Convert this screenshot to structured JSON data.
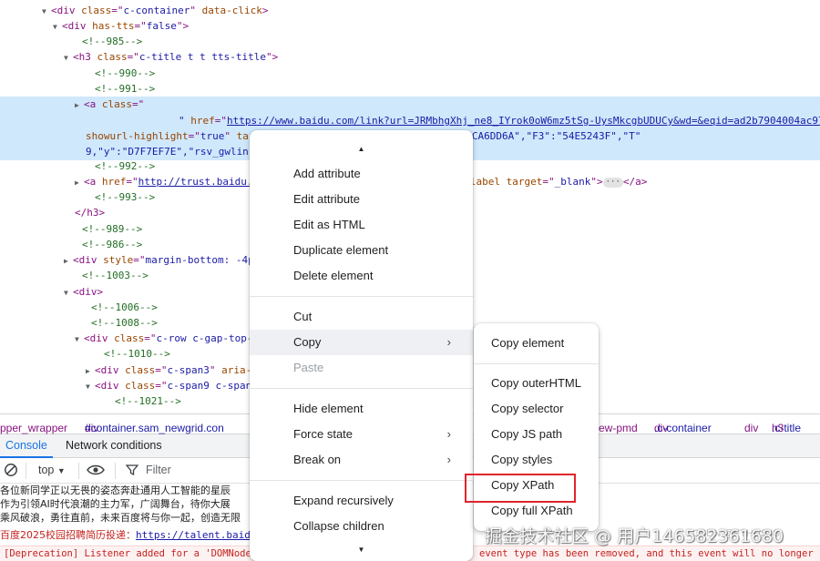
{
  "elements": {
    "lines": [
      {
        "tokens": [
          [
            "tri",
            "▼"
          ],
          [
            "tag",
            "<div "
          ],
          [
            "attr",
            "class"
          ],
          [
            "tag",
            "=\""
          ],
          [
            "val",
            "c-container"
          ],
          [
            "tag",
            "\" "
          ],
          [
            "attr",
            "data-click"
          ],
          [
            "tag",
            ">"
          ]
        ]
      },
      {
        "tokens": [
          [
            "tri",
            "▼"
          ],
          [
            "tag",
            "<div "
          ],
          [
            "attr",
            "has-tts"
          ],
          [
            "tag",
            "=\""
          ],
          [
            "val",
            "false"
          ],
          [
            "tag",
            "\">"
          ]
        ]
      },
      {
        "tokens": [
          [
            "cmt",
            "<!--985-->"
          ]
        ]
      },
      {
        "tokens": [
          [
            "tri",
            "▼"
          ],
          [
            "tag",
            "<h3 "
          ],
          [
            "attr",
            "class"
          ],
          [
            "tag",
            "=\""
          ],
          [
            "val",
            "c-title t t tts-title"
          ],
          [
            "tag",
            "\">"
          ]
        ]
      },
      {
        "tokens": [
          [
            "cmt",
            "<!--990-->"
          ]
        ]
      },
      {
        "tokens": [
          [
            "cmt",
            "<!--991-->"
          ]
        ]
      },
      {
        "tokens": [
          [
            "tri",
            "▶"
          ],
          [
            "tag",
            "<a "
          ],
          [
            "attr",
            "class"
          ],
          [
            "tag",
            "=\""
          ]
        ]
      },
      {
        "tokens": [
          [
            "val",
            "\" "
          ],
          [
            "attr",
            "href"
          ],
          [
            "tag",
            "=\""
          ],
          [
            "link",
            "https://www.baidu.com/link?url=JRMbhgXhj_ne8_IYrok0oW6mz5tSg-UysMkcgbUDUCy&wd=&eqid=ad2b7904004ac97b000000066"
          ]
        ]
      },
      {
        "tokens": [
          [
            "attr",
            "showurl-highlight"
          ],
          [
            "tag",
            "=\""
          ],
          [
            "val",
            "true"
          ],
          [
            "tag",
            "\" "
          ],
          [
            "attr",
            "targ"
          ],
          [
            "val",
            "                                                  \"778317EA\",\"F1\":\"9D73F1E4\",\"F2\":\"4CA6DD6A\",\"F3\":\"54E5243F\",\"T\""
          ]
        ]
      },
      {
        "tokens": [
          [
            "val",
            "9,\"y\":\"D7F7EF7E\",\"rsv_gwlink\""
          ]
        ]
      },
      {
        "tokens": [
          [
            "cmt",
            "<!--992-->"
          ]
        ]
      },
      {
        "tokens": [
          [
            "tri",
            "▶"
          ],
          [
            "tag",
            "<a "
          ],
          [
            "attr",
            "href"
          ],
          [
            "tag",
            "=\""
          ],
          [
            "link",
            "http://trust.baidu."
          ],
          [
            "val",
            "                                                        label_2A093 c-gap-left-small\" "
          ],
          [
            "attr",
            "aria-label target"
          ],
          [
            "tag",
            "=\""
          ],
          [
            "val",
            "_blank"
          ],
          [
            "tag",
            "\">"
          ],
          [
            "ell",
            "···"
          ],
          [
            "tag",
            "</a>"
          ]
        ]
      },
      {
        "tokens": [
          [
            "cmt",
            "<!--993-->"
          ]
        ]
      },
      {
        "tokens": [
          [
            "tag",
            "</h3>"
          ]
        ]
      },
      {
        "tokens": [
          [
            "cmt",
            "<!--989-->"
          ]
        ]
      },
      {
        "tokens": [
          [
            "cmt",
            "<!--986-->"
          ]
        ]
      },
      {
        "tokens": [
          [
            "tri",
            "▶"
          ],
          [
            "tag",
            "<div "
          ],
          [
            "attr",
            "style"
          ],
          [
            "tag",
            "=\""
          ],
          [
            "val",
            "margin-bottom: -4px"
          ]
        ]
      },
      {
        "tokens": [
          [
            "cmt",
            "<!--1003-->"
          ]
        ]
      },
      {
        "tokens": [
          [
            "tri",
            "▼"
          ],
          [
            "tag",
            "<div>"
          ]
        ]
      },
      {
        "tokens": [
          [
            "cmt",
            "<!--1006-->"
          ]
        ]
      },
      {
        "tokens": [
          [
            "cmt",
            "<!--1008-->"
          ]
        ]
      },
      {
        "tokens": [
          [
            "tri",
            "▼"
          ],
          [
            "tag",
            "<div "
          ],
          [
            "attr",
            "class"
          ],
          [
            "tag",
            "=\""
          ],
          [
            "val",
            "c-row c-gap-top-m"
          ]
        ]
      },
      {
        "tokens": [
          [
            "cmt",
            "<!--1010-->"
          ]
        ]
      },
      {
        "tokens": [
          [
            "tri",
            "▶"
          ],
          [
            "tag",
            "<div "
          ],
          [
            "attr",
            "class"
          ],
          [
            "tag",
            "=\""
          ],
          [
            "val",
            "c-span3"
          ],
          [
            "tag",
            "\" "
          ],
          [
            "attr",
            "aria-h"
          ]
        ]
      },
      {
        "tokens": [
          [
            "tri",
            "▼"
          ],
          [
            "tag",
            "<div "
          ],
          [
            "attr",
            "class"
          ],
          [
            "tag",
            "=\""
          ],
          [
            "val",
            "c-span9 c-span-"
          ]
        ]
      },
      {
        "tokens": [
          [
            "cmt",
            "<!--1021-->"
          ]
        ]
      }
    ]
  },
  "breadcrumbs": [
    {
      "tag": "pper_wrapper",
      "cls": ""
    },
    {
      "tag": "div",
      "cls": "#container.sam_newgrid.con"
    },
    {
      "tag": "ew-pmd",
      "cls": ""
    },
    {
      "tag": "div",
      "cls": ".c-container"
    },
    {
      "tag": "div",
      "cls": ""
    },
    {
      "tag": "h3",
      "cls": ".c-title"
    }
  ],
  "drawer": {
    "tabs": [
      "Console",
      "Network conditions"
    ]
  },
  "console_toolbar": {
    "context": "top",
    "filter_placeholder": "Filter"
  },
  "console_messages": [
    "各位新同学正以无畏的姿态奔赴通用人工智能的星辰",
    "作为引领AI时代浪潮的主力军，广阔舞台，待你大展",
    "乘风破浪，勇往直前，未来百度将与你一起，创造无限"
  ],
  "console_error": {
    "text": "百度2025校园招聘简历投递：",
    "link": "https://talent.baidu."
  },
  "deprecation": {
    "left": "[Deprecation] Listener added for a 'DOMNodeI",
    "right": "event type has been removed, and this event will no longer be"
  },
  "context_menu": {
    "items": [
      {
        "label": "Add attribute"
      },
      {
        "label": "Edit attribute"
      },
      {
        "label": "Edit as HTML"
      },
      {
        "label": "Duplicate element"
      },
      {
        "label": "Delete element"
      },
      {
        "label": "Cut"
      },
      {
        "label": "Copy"
      },
      {
        "label": "Paste"
      },
      {
        "label": "Hide element"
      },
      {
        "label": "Force state"
      },
      {
        "label": "Break on"
      },
      {
        "label": "Expand recursively"
      },
      {
        "label": "Collapse children"
      }
    ]
  },
  "copy_submenu": {
    "items": [
      {
        "label": "Copy element"
      },
      {
        "label": "Copy outerHTML"
      },
      {
        "label": "Copy selector"
      },
      {
        "label": "Copy JS path"
      },
      {
        "label": "Copy styles"
      },
      {
        "label": "Copy XPath"
      },
      {
        "label": "Copy full XPath"
      }
    ]
  },
  "watermark": "掘金技术社区 @ 用户146582361680",
  "watermark_small": "CSDN @FTHUS IS",
  "colors": {
    "selection": "#cfe8fc",
    "highlight_border": "#e0242b",
    "error": "#c5221f",
    "accent": "#1a73e8"
  }
}
